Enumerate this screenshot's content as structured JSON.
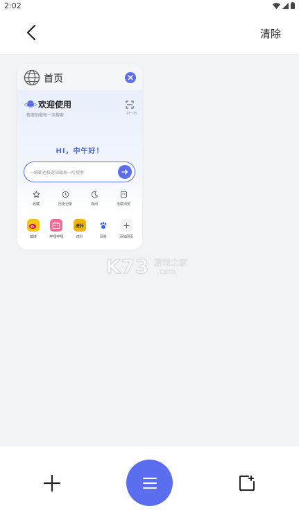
{
  "status_bar": {
    "time": "2:02"
  },
  "header": {
    "clear_label": "清除"
  },
  "tab_card": {
    "title": "首页",
    "welcome_title": "欢迎使用",
    "welcome_subtitle": "极速加载每一次搜索",
    "scan_label": "扫一扫",
    "greeting": "HI，中午好！",
    "search_placeholder": "一触即达极速加载每一阶搜索",
    "quick_links": [
      {
        "label": "收藏",
        "icon": "star-icon"
      },
      {
        "label": "历史记录",
        "icon": "clock-icon"
      },
      {
        "label": "夜间",
        "icon": "moon-icon"
      },
      {
        "label": "无痕浏览",
        "icon": "incognito-icon"
      }
    ],
    "apps": [
      {
        "label": "微博",
        "icon": "weibo-icon",
        "color": "#f7c21a"
      },
      {
        "label": "哔哩哔哩",
        "icon": "bilibili-icon",
        "color": "#f06a96"
      },
      {
        "label": "虎扑",
        "icon": "hupu-icon",
        "color": "#f0b400",
        "text": "虎扑"
      },
      {
        "label": "百度",
        "icon": "baidu-icon",
        "color": "#ffffff"
      },
      {
        "label": "添加网页",
        "icon": "plus-icon",
        "color": "#f2f2f2"
      }
    ]
  },
  "watermark": {
    "brand": "K73",
    "cn": "游戏之家",
    "domain": ".com"
  },
  "colors": {
    "accent": "#5b6ef0",
    "background": "#f2f3f5"
  }
}
